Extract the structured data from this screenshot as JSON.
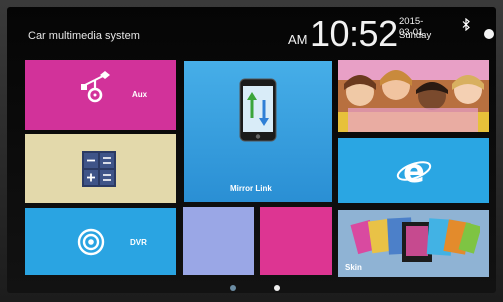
{
  "header": {
    "title": "Car multimedia system",
    "ampm": "AM",
    "time": "10:52",
    "date": "2015-03-01",
    "day": "Sunday"
  },
  "tiles": {
    "aux": {
      "label": "Aux"
    },
    "mirror": {
      "label": "Mirror Link"
    },
    "dvr": {
      "label": "DVR"
    },
    "skin": {
      "label": "Skin"
    }
  },
  "pager": {
    "pages": 2,
    "active": 2
  },
  "colors": {
    "magenta": "#d2329a",
    "cyan": "#2aa4e2",
    "beige": "#e3d9ab",
    "lavender": "#9aa7e6"
  },
  "icons": [
    "bluetooth-icon",
    "aux-connector-icon",
    "calculator-icon",
    "phone-sync-icon",
    "dvr-target-icon",
    "internet-explorer-icon",
    "skin-gallery-icon",
    "photo-thumbnail"
  ]
}
